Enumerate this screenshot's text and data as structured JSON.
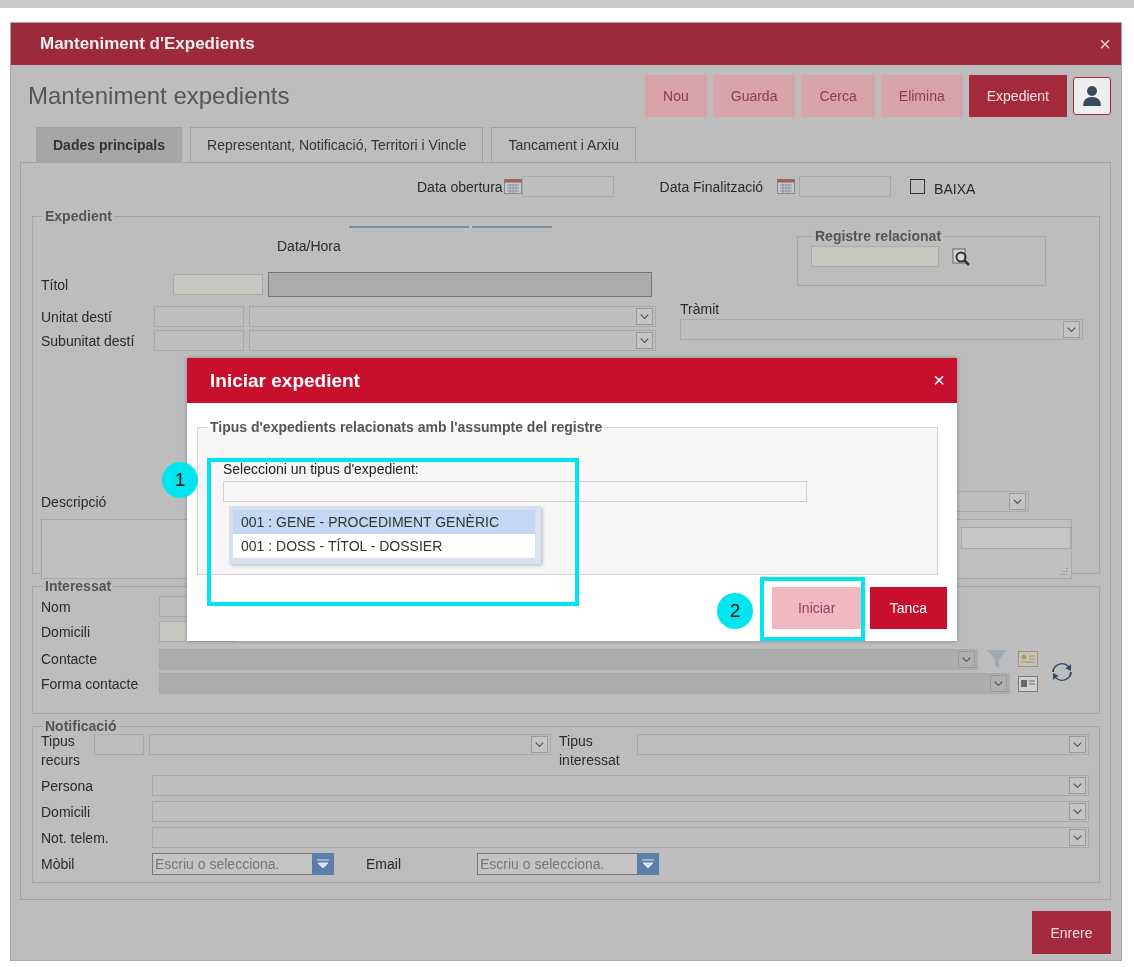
{
  "window": {
    "title": "Manteniment d'Expedients",
    "close": "×"
  },
  "page_title": "Manteniment expedients",
  "toolbar": [
    {
      "label": "Nou",
      "disabled": true
    },
    {
      "label": "Guarda",
      "disabled": true
    },
    {
      "label": "Cerca",
      "disabled": true
    },
    {
      "label": "Elimina",
      "disabled": true
    },
    {
      "label": "Expedient",
      "disabled": false
    }
  ],
  "tabs": [
    {
      "label": "Dades principals",
      "selected": true
    },
    {
      "label": "Representant, Notificació, Territori i Vincle",
      "selected": false
    },
    {
      "label": "Tancament i Arxiu",
      "selected": false
    }
  ],
  "dates": {
    "opening_label": "Data obertura",
    "closing_label": "Data Finalització",
    "baixa": {
      "label": "BAIXA",
      "checked": false
    }
  },
  "expedient": {
    "legend": "Expedient",
    "datetime_label": "Data/Hora",
    "registre_legend": "Registre relacionat",
    "title_label": "Títol",
    "unit_label": "Unitat destí",
    "subunit_label": "Subunitat destí",
    "tramit_label": "Tràmit",
    "description_label": "Descripció"
  },
  "interessat": {
    "legend": "Interessat",
    "name_label": "Nom",
    "address_label": "Domicili",
    "contact_label": "Contacte",
    "contact_form_label": "Forma contacte"
  },
  "notificacio": {
    "legend": "Notificació",
    "resource_type_label": "Tipus recurs",
    "interested_type_label": "Tipus interessat",
    "person_label": "Persona",
    "address_label": "Domicili",
    "telematic_label": "Not. telem.",
    "mobile": {
      "label": "Mòbil",
      "placeholder": "Escriu o selecciona."
    },
    "email": {
      "label": "Email",
      "placeholder": "Escriu o selecciona."
    }
  },
  "back_button": "Enrere",
  "dialog": {
    "title": "Iniciar expedient",
    "close": "×",
    "legend": "Tipus d'expedients relacionats amb l'assumpte del registre",
    "select_label": "Seleccioni un tipus d'expedient:",
    "options": [
      {
        "label": "001 : GENE - PROCEDIMENT GENÈRIC",
        "selected": true
      },
      {
        "label": "001 : DOSS - TÍTOL - DOSSIER",
        "selected": false
      }
    ],
    "buttons": [
      {
        "label": "Iniciar",
        "disabled": true,
        "kind": "primary"
      },
      {
        "label": "Tanca",
        "disabled": false,
        "kind": "primary"
      }
    ]
  },
  "callouts": [
    {
      "number": "1"
    },
    {
      "number": "2"
    }
  ]
}
